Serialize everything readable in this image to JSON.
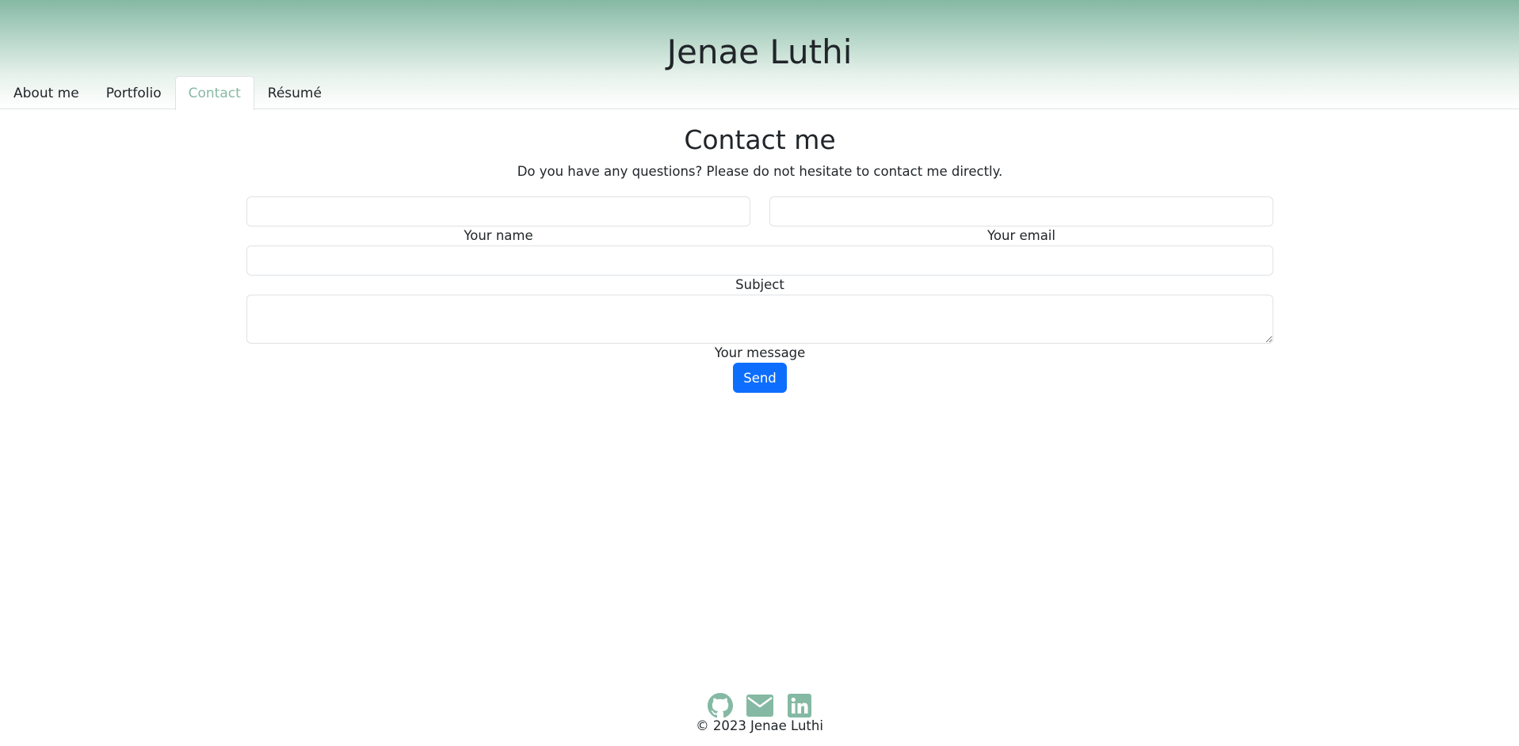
{
  "site": {
    "title": "Jenae Luthi"
  },
  "nav": {
    "tabs": [
      {
        "label": "About me",
        "active": false
      },
      {
        "label": "Portfolio",
        "active": false
      },
      {
        "label": "Contact",
        "active": true
      },
      {
        "label": "Résumé",
        "active": false
      }
    ]
  },
  "contact": {
    "heading": "Contact me",
    "intro": "Do you have any questions? Please do not hesitate to contact me directly.",
    "fields": {
      "name": {
        "label": "Your name",
        "value": ""
      },
      "email": {
        "label": "Your email",
        "value": ""
      },
      "subject": {
        "label": "Subject",
        "value": ""
      },
      "message": {
        "label": "Your message",
        "value": ""
      }
    },
    "send_label": "Send"
  },
  "footer": {
    "icons": [
      "github-icon",
      "envelope-icon",
      "linkedin-icon"
    ],
    "copyright": "© 2023 Jenae Luthi"
  },
  "colors": {
    "accent": "#85b9a4",
    "primary_button": "#0d6efd",
    "text": "#212529",
    "border": "#dee2e6"
  }
}
